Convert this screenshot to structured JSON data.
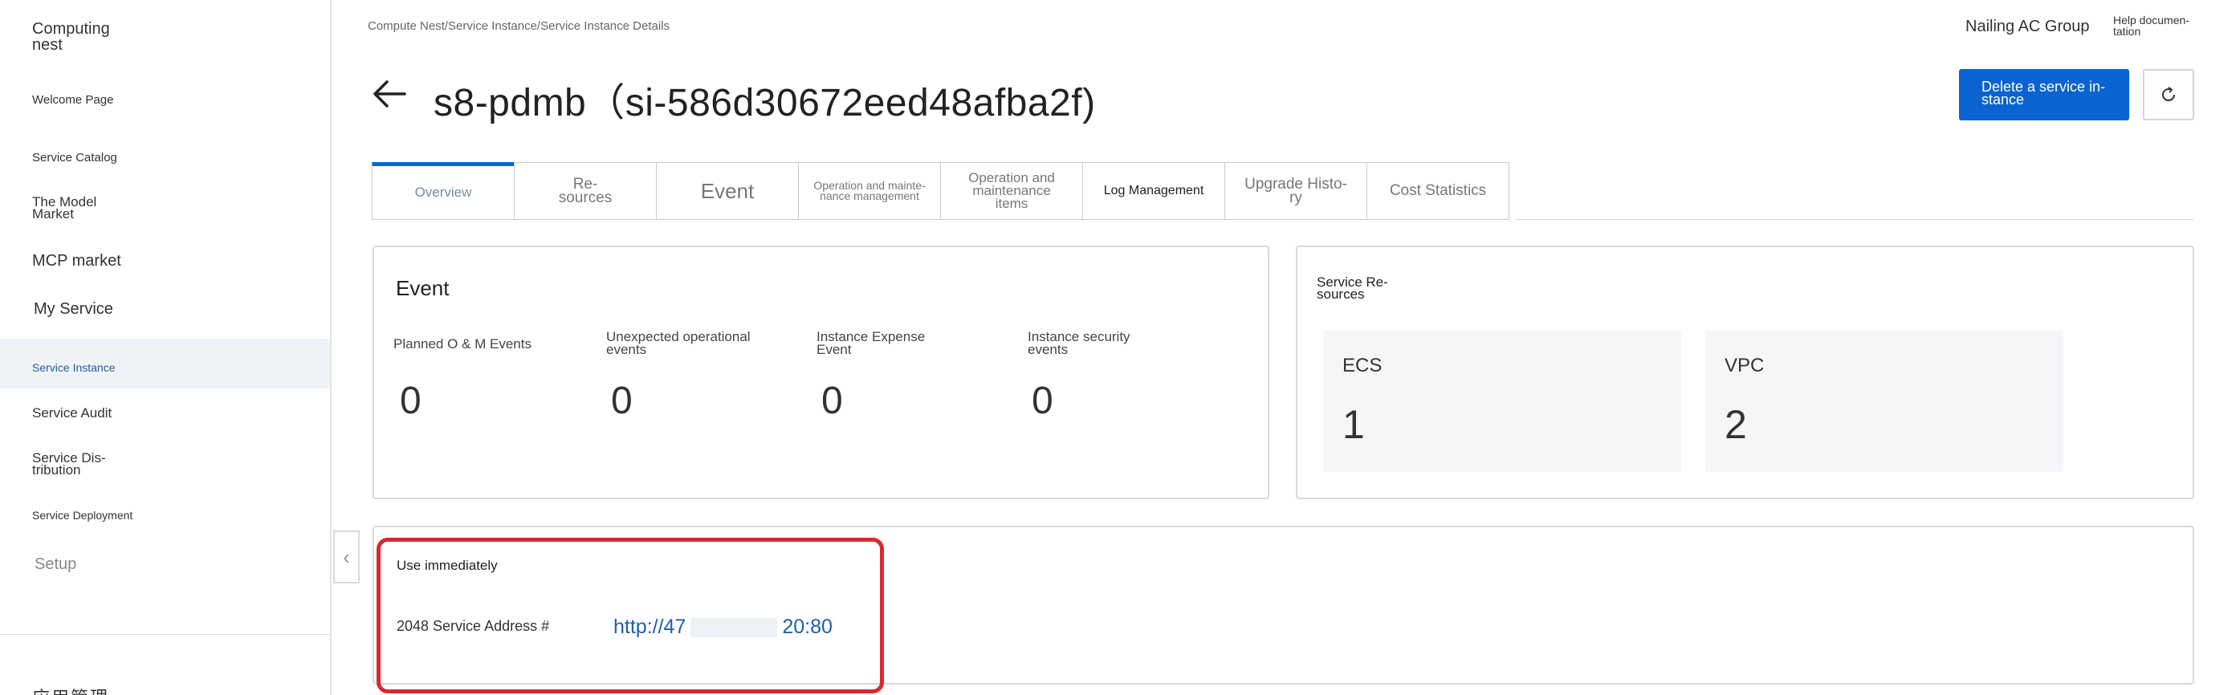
{
  "sidebar": {
    "title": "Computing nest",
    "items": [
      {
        "label": "Welcome Page"
      },
      {
        "label": "Service Catalog"
      },
      {
        "label": "The Model Market"
      },
      {
        "label": "MCP market"
      },
      {
        "label": "My Service"
      },
      {
        "label": "Service Instance"
      },
      {
        "label": "Service Audit"
      },
      {
        "label": "Service Dis-tribution"
      },
      {
        "label": "Service Deployment"
      },
      {
        "label": "Setup"
      }
    ],
    "cut_label": "应用管理"
  },
  "header": {
    "breadcrumb": "Compute Nest/Service Instance/Service Instance Details",
    "org": "Nailing AC Group",
    "help": "Help documen-tation",
    "title": "s8-pdmb（si-586d30672eed48afba2f)",
    "delete_label": "Delete a service in-stance"
  },
  "tabs": [
    {
      "label": "Overview"
    },
    {
      "label": "Re-sources"
    },
    {
      "label": "Event"
    },
    {
      "label": "Operation and mainte-nance management"
    },
    {
      "label": "Operation and maintenance items"
    },
    {
      "label": "Log Management"
    },
    {
      "label": "Upgrade Histo-ry"
    },
    {
      "label": "Cost Statistics"
    }
  ],
  "event_card": {
    "title": "Event",
    "metrics": [
      {
        "label": "Planned O & M Events",
        "value": "0"
      },
      {
        "label": "Unexpected operational events",
        "value": "0"
      },
      {
        "label": "Instance Expense Event",
        "value": "0"
      },
      {
        "label": "Instance security events",
        "value": "0"
      }
    ]
  },
  "resources_card": {
    "title": "Service Re-sources",
    "items": [
      {
        "name": "ECS",
        "count": "1"
      },
      {
        "name": "VPC",
        "count": "2"
      }
    ]
  },
  "use_card": {
    "title": "Use immediately",
    "address_label": "2048 Service Address #",
    "link_prefix": "http://47",
    "link_suffix": "20:80"
  },
  "colors": {
    "primary": "#0a63d0",
    "highlight": "#d9282f",
    "link": "#1f5fa8",
    "active_bg": "#eff3f8"
  }
}
